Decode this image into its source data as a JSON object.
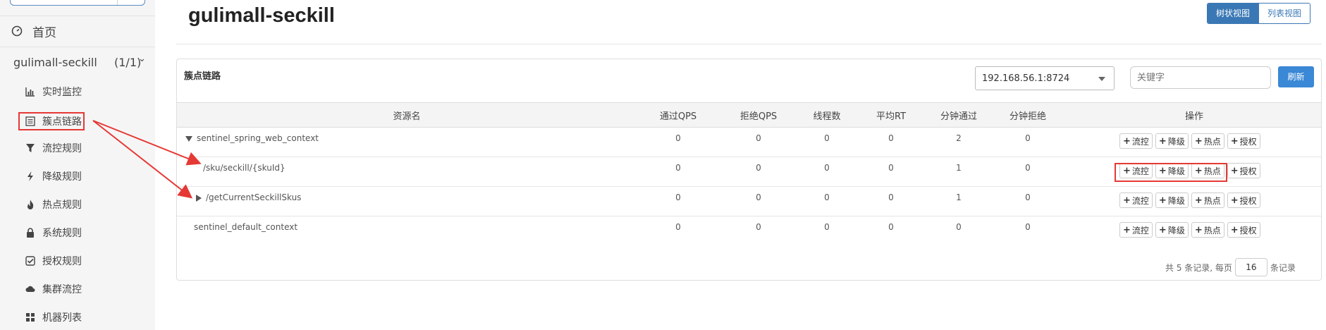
{
  "sidebar": {
    "home_label": "首页",
    "app": {
      "name": "gulimall-seckill",
      "count": "(1/1)"
    },
    "items": [
      {
        "label": "实时监控",
        "icon": "bar-chart-icon"
      },
      {
        "label": "簇点链路",
        "icon": "list-icon"
      },
      {
        "label": "流控规则",
        "icon": "filter-icon"
      },
      {
        "label": "降级规则",
        "icon": "flash-icon"
      },
      {
        "label": "热点规则",
        "icon": "fire-icon"
      },
      {
        "label": "系统规则",
        "icon": "lock-icon"
      },
      {
        "label": "授权规则",
        "icon": "check-square-icon"
      },
      {
        "label": "集群流控",
        "icon": "cloud-icon"
      },
      {
        "label": "机器列表",
        "icon": "grid-icon"
      }
    ]
  },
  "header": {
    "title": "gulimall-seckill",
    "tree_view": "树状视图",
    "list_view": "列表视图"
  },
  "panel": {
    "title": "簇点链路",
    "machine": "192.168.56.1:8724",
    "keyword_placeholder": "关键字",
    "refresh": "刷新"
  },
  "table": {
    "columns": [
      "资源名",
      "通过QPS",
      "拒绝QPS",
      "线程数",
      "平均RT",
      "分钟通过",
      "分钟拒绝",
      "操作"
    ],
    "rows": [
      {
        "name": "sentinel_spring_web_context",
        "expand": "down",
        "values": [
          "0",
          "0",
          "0",
          "0",
          "2",
          "0"
        ]
      },
      {
        "name": "/sku/seckill/{skuId}",
        "expand": "none",
        "values": [
          "0",
          "0",
          "0",
          "0",
          "1",
          "0"
        ]
      },
      {
        "name": "/getCurrentSeckillSkus",
        "expand": "right",
        "values": [
          "0",
          "0",
          "0",
          "0",
          "1",
          "0"
        ]
      },
      {
        "name": "sentinel_default_context",
        "expand": "none",
        "values": [
          "0",
          "0",
          "0",
          "0",
          "0",
          "0"
        ]
      }
    ],
    "actions": {
      "flow": "流控",
      "degrade": "降级",
      "hot": "热点",
      "auth": "授权"
    }
  },
  "pagination": {
    "prefix": "共 5 条记录, 每页",
    "page_size": "16",
    "suffix": "条记录"
  },
  "colors": {
    "primary": "#3a78b5",
    "highlight": "#e53935"
  }
}
